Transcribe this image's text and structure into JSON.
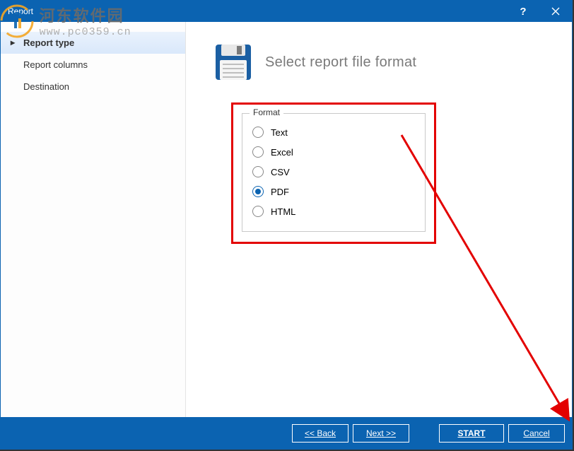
{
  "window": {
    "title": "Report"
  },
  "sidebar": {
    "items": [
      {
        "label": "Report type",
        "active": true
      },
      {
        "label": "Report columns",
        "active": false
      },
      {
        "label": "Destination",
        "active": false
      }
    ]
  },
  "main": {
    "title": "Select report file format",
    "fieldset_label": "Format",
    "options": [
      {
        "label": "Text",
        "selected": false
      },
      {
        "label": "Excel",
        "selected": false
      },
      {
        "label": "CSV",
        "selected": false
      },
      {
        "label": "PDF",
        "selected": true
      },
      {
        "label": "HTML",
        "selected": false
      }
    ]
  },
  "footer": {
    "back": "<< Back",
    "next": "Next >>",
    "start": "START",
    "cancel": "Cancel"
  },
  "watermark": {
    "cn": "河东软件园",
    "url": "www.pc0359.cn"
  }
}
